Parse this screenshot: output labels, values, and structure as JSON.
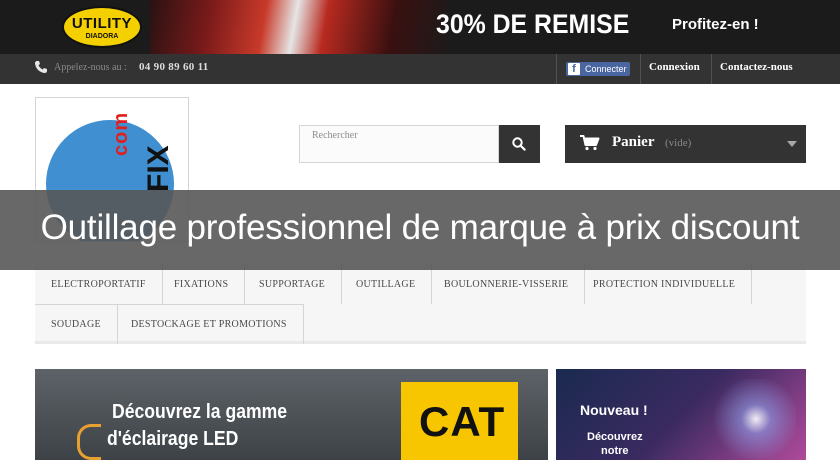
{
  "banner": {
    "brand_name": "UTILITY",
    "brand_sub": "DIADORA",
    "promo": "30% DE REMISE",
    "cta": "Profitez-en !"
  },
  "topnav": {
    "call_label": "Appelez-nous au :",
    "phone": "04 90 89 60 11",
    "facebook_label": "Connecter",
    "login": "Connexion",
    "contact": "Contactez-nous"
  },
  "header": {
    "logo_com": "com",
    "logo_fix": "FIX",
    "search_placeholder": "Rechercher",
    "cart_label": "Panier",
    "cart_status": "(vide)"
  },
  "overlay": {
    "tagline": "Outillage professionnel de marque à prix discount"
  },
  "menu": {
    "row1": [
      "ELECTROPORTATIF",
      "FIXATIONS",
      "SUPPORTAGE",
      "OUTILLAGE",
      "BOULONNERIE-VISSERIE",
      "PROTECTION INDIVIDUELLE"
    ],
    "row2": [
      "SOUDAGE",
      "DESTOCKAGE ET PROMOTIONS"
    ]
  },
  "slider": {
    "main_line1": "Découvrez la gamme",
    "main_line2": "d'éclairage LED",
    "cat_logo": "CAT",
    "side_title": "Nouveau !",
    "side_line1": "Découvrez",
    "side_line2": "notre"
  },
  "colors": {
    "dark_bar": "#333333",
    "overlay": "#585858",
    "facebook": "#4a66a0",
    "brand_yellow": "#f5d000"
  }
}
